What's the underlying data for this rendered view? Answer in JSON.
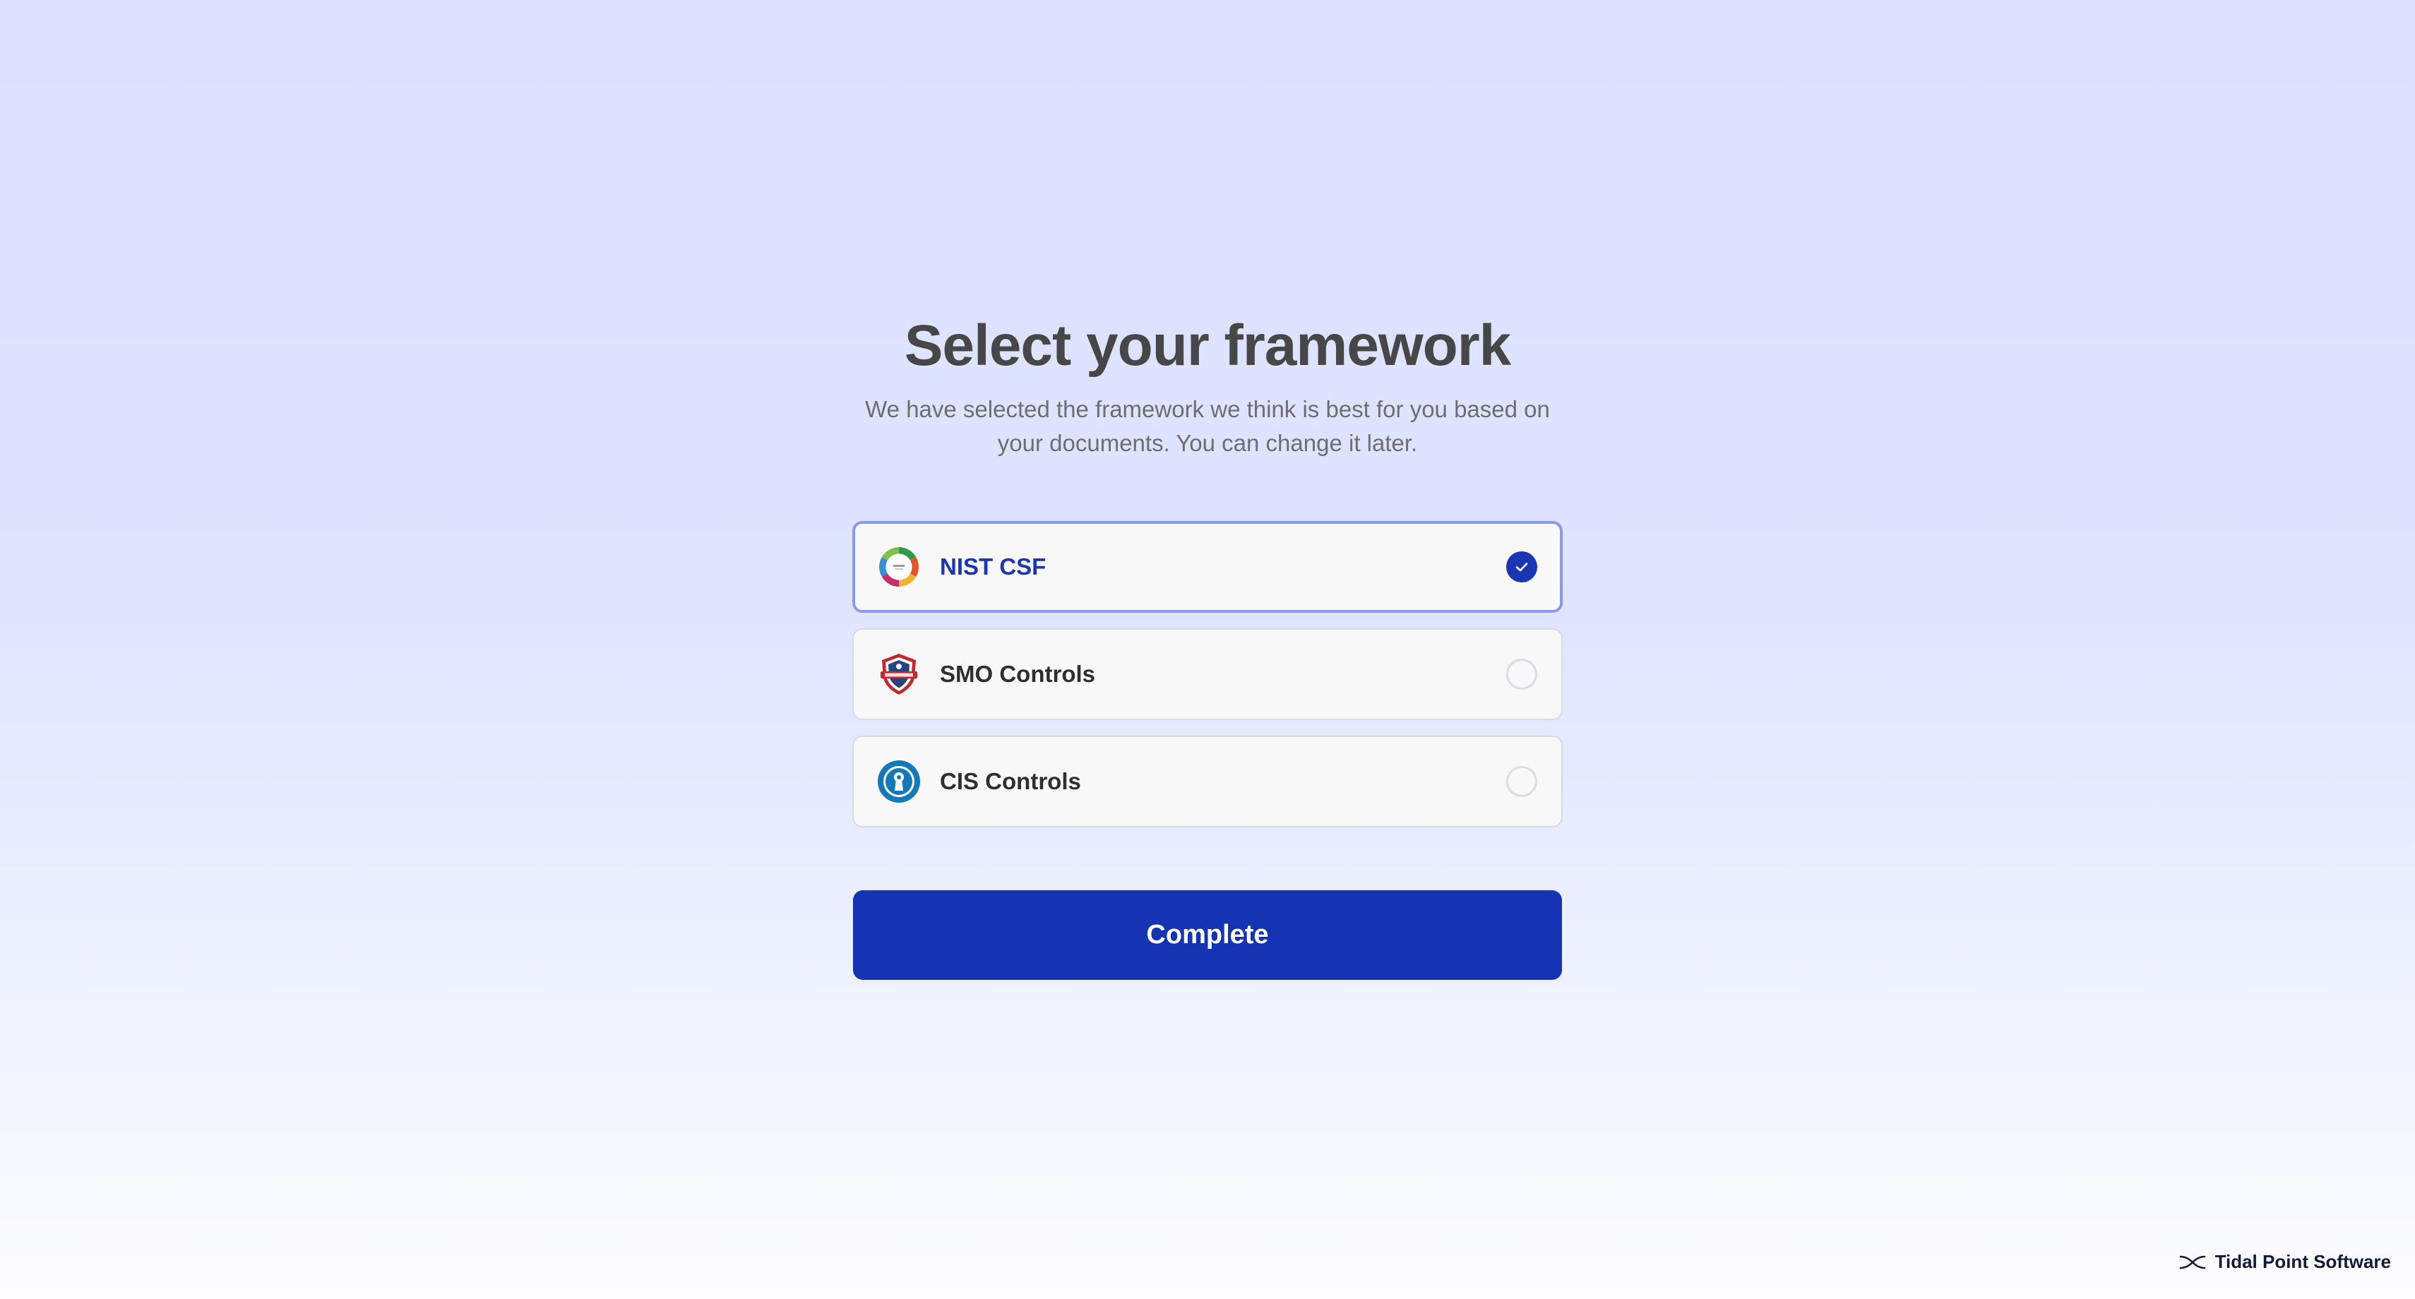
{
  "header": {
    "title": "Select your framework",
    "subtitle": "We have selected the framework we think is best for you based on your documents. You can change it later."
  },
  "frameworks": [
    {
      "label": "NIST CSF",
      "icon": "nist-csf-logo-icon",
      "selected": true
    },
    {
      "label": "SMO Controls",
      "icon": "security-shield-logo-icon",
      "selected": false
    },
    {
      "label": "CIS Controls",
      "icon": "cis-keyhole-logo-icon",
      "selected": false
    }
  ],
  "actions": {
    "complete_label": "Complete"
  },
  "brand": {
    "name": "Tidal Point Software",
    "icon": "crossed-waves-icon"
  },
  "colors": {
    "accent": "#1434b4",
    "selected_border": "#8a99ef",
    "background_top": "#dbe1ff",
    "background_bottom": "#fdfdff"
  }
}
